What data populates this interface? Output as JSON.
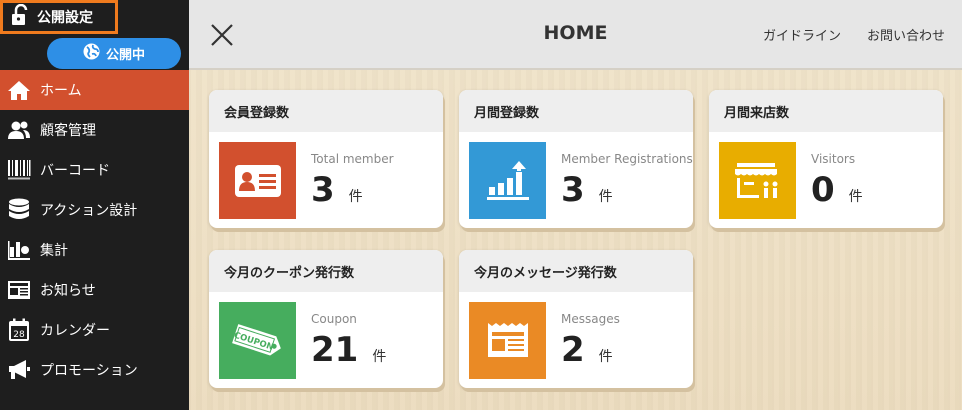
{
  "sidebar": {
    "publish_setting": "公開設定",
    "publish_status": "公開中",
    "items": [
      {
        "label": "ホーム",
        "icon": "home-icon"
      },
      {
        "label": "顧客管理",
        "icon": "users-icon"
      },
      {
        "label": "バーコード",
        "icon": "barcode-icon"
      },
      {
        "label": "アクション設計",
        "icon": "database-icon"
      },
      {
        "label": "集計",
        "icon": "stats-icon"
      },
      {
        "label": "お知らせ",
        "icon": "newspaper-icon"
      },
      {
        "label": "カレンダー",
        "icon": "calendar-icon"
      },
      {
        "label": "プロモーション",
        "icon": "megaphone-icon"
      }
    ]
  },
  "header": {
    "title": "HOME",
    "links": {
      "guideline": "ガイドライン",
      "contact": "お問い合わせ"
    }
  },
  "cards": [
    {
      "title": "会員登録数",
      "label": "Total member",
      "value": "3",
      "unit": "件",
      "color": "#d2502e",
      "icon": "id-card-icon"
    },
    {
      "title": "月間登録数",
      "label": "Member Registrations",
      "value": "3",
      "unit": "件",
      "color": "#3399d6",
      "icon": "growth-chart-icon"
    },
    {
      "title": "月間来店数",
      "label": "Visitors",
      "value": "0",
      "unit": "件",
      "color": "#e8ad00",
      "icon": "store-icon"
    },
    {
      "title": "今月のクーポン発行数",
      "label": "Coupon",
      "value": "21",
      "unit": "件",
      "color": "#46ad5e",
      "icon": "coupon-icon",
      "icon_text": "COUPON"
    },
    {
      "title": "今月のメッセージ発行数",
      "label": "Messages",
      "value": "2",
      "unit": "件",
      "color": "#ea8a25",
      "icon": "newspaper-icon"
    }
  ],
  "colors": {
    "accent": "#d2502e",
    "highlight": "#f07b1e",
    "status": "#2e8fe6"
  }
}
